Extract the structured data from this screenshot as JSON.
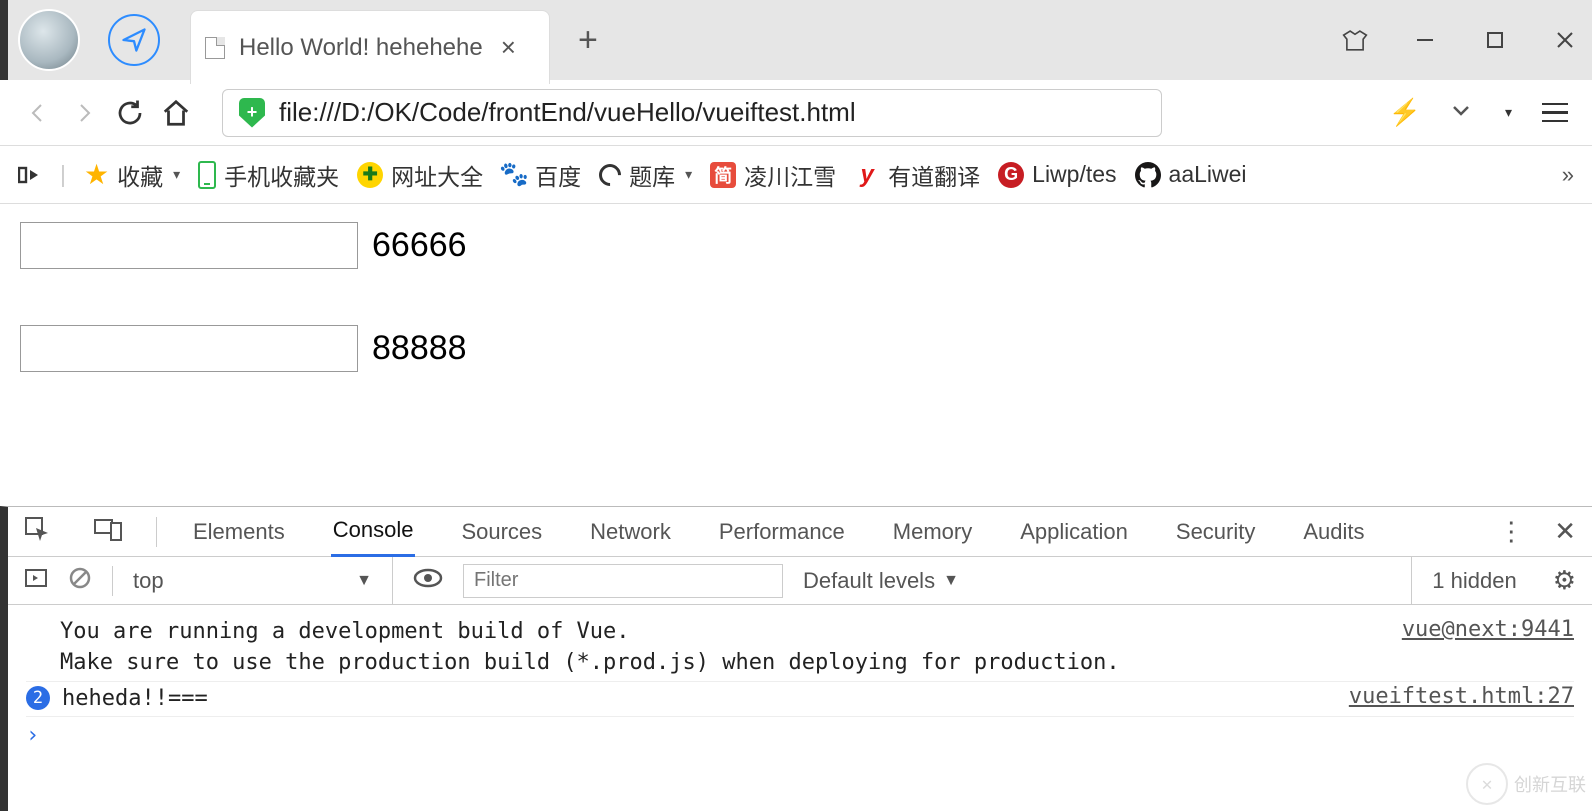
{
  "titlebar": {
    "tab_title": "Hello World! hehehehe",
    "new_tab_glyph": "+",
    "close_glyph": "×"
  },
  "address": {
    "url": "file:///D:/OK/Code/frontEnd/vueHello/vueiftest.html"
  },
  "bookmarks": {
    "fav_label": "收藏",
    "mobile_label": "手机收藏夹",
    "items": [
      {
        "label": "网址大全"
      },
      {
        "label": "百度"
      },
      {
        "label": "题库"
      },
      {
        "label": "凌川江雪"
      },
      {
        "label": "有道翻译"
      },
      {
        "label": "Liwp/tes"
      },
      {
        "label": "aaLiwei"
      }
    ],
    "more_glyph": "»"
  },
  "page": {
    "rows": [
      {
        "value": "66666"
      },
      {
        "value": "88888"
      }
    ]
  },
  "devtools": {
    "tabs": [
      "Elements",
      "Console",
      "Sources",
      "Network",
      "Performance",
      "Memory",
      "Application",
      "Security",
      "Audits"
    ],
    "active_tab": "Console",
    "context": "top",
    "filter_placeholder": "Filter",
    "levels_label": "Default levels",
    "hidden_label": "1 hidden",
    "messages": [
      {
        "text": "You are running a development build of Vue.\nMake sure to use the production build (*.prod.js) when deploying for production.",
        "src": "vue@next:9441"
      },
      {
        "count": 2,
        "text": "heheda!!===",
        "src": "vueiftest.html:27"
      }
    ],
    "prompt_glyph": "›"
  },
  "watermark": {
    "text": "创新互联"
  }
}
